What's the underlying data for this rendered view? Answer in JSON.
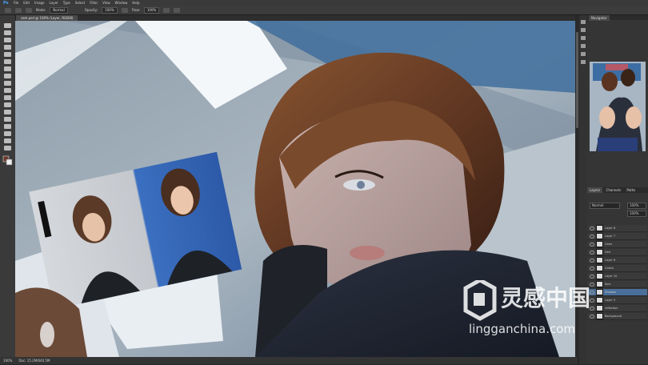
{
  "app": {
    "name": "Ps"
  },
  "menu": [
    "File",
    "Edit",
    "Image",
    "Layer",
    "Type",
    "Select",
    "Filter",
    "View",
    "Window",
    "Help"
  ],
  "options": {
    "mode_label": "Mode:",
    "mode_value": "Normal",
    "opacity_label": "Opacity:",
    "opacity_value": "100%",
    "flow_label": "Flow:",
    "flow_value": "100%"
  },
  "document": {
    "tab_label": "sam.psd @ 100% (Layer, RGB/8)"
  },
  "status": {
    "zoom": "100%",
    "doc": "Doc: 15.2M/640.5M"
  },
  "panels": {
    "top_tab": "Navigator",
    "layers_tabs": [
      "Layers",
      "Channels",
      "Paths"
    ],
    "blend_mode": "Normal",
    "opacity": "100%",
    "fill": "100%",
    "layers": [
      "Layer 8",
      "Layer 7",
      "Lines",
      "Hair",
      "Layer 6",
      "Colors",
      "Layer 10",
      "face",
      "Shadow",
      "Layer 5",
      "reflection",
      "Background"
    ]
  },
  "watermark": {
    "brand": "灵感中国",
    "url": "lingganchina.com"
  },
  "colors": {
    "accent": "#4aa3ff",
    "panel": "#353535",
    "canvas_bg": "#9aa7b3",
    "watermark": "#ffffff"
  }
}
